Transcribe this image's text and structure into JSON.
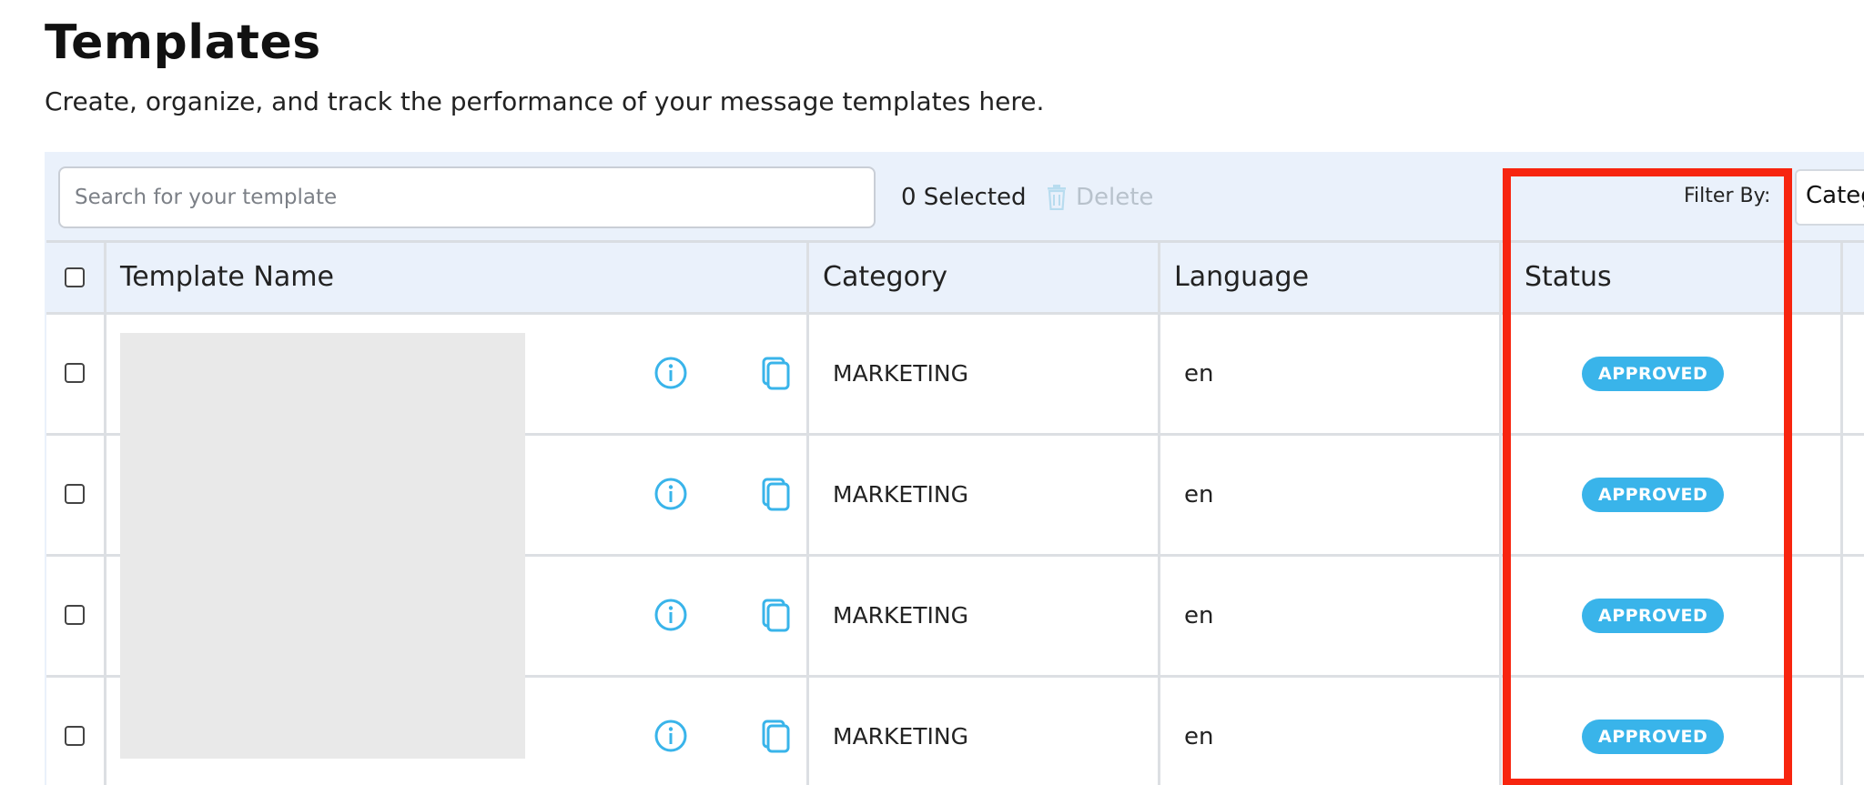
{
  "header": {
    "title": "Templates",
    "subtitle": "Create, organize, and track the performance of your message templates here."
  },
  "toolbar": {
    "search_placeholder": "Search for your template",
    "selected_label": "0 Selected",
    "delete_label": "Delete",
    "filter_label": "Filter By:",
    "filter_value": "Categ"
  },
  "table": {
    "columns": {
      "name": "Template Name",
      "category": "Category",
      "language": "Language",
      "status": "Status"
    },
    "rows": [
      {
        "category": "MARKETING",
        "language": "en",
        "status": "APPROVED"
      },
      {
        "category": "MARKETING",
        "language": "en",
        "status": "APPROVED"
      },
      {
        "category": "MARKETING",
        "language": "en",
        "status": "APPROVED"
      },
      {
        "category": "MARKETING",
        "language": "en",
        "status": "APPROVED"
      }
    ]
  },
  "icons": {
    "info": "info-icon",
    "copy": "copy-icon",
    "trash": "trash-icon"
  },
  "colors": {
    "accent": "#39b4ea",
    "highlight": "#f7250f",
    "header_bg": "#eaf1fb"
  }
}
